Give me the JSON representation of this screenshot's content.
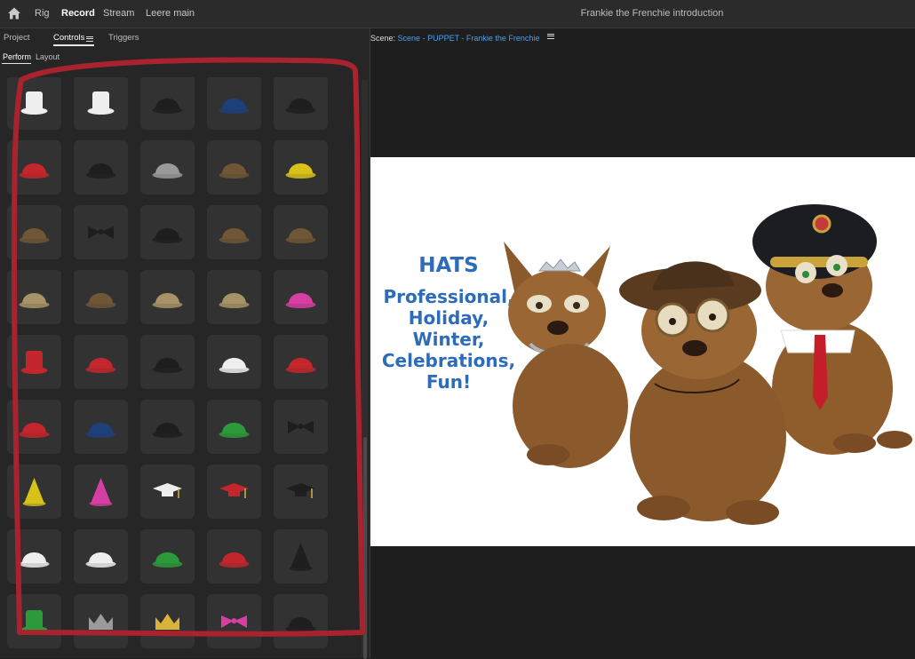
{
  "header": {
    "nav": [
      "Rig",
      "Record",
      "Stream",
      "Leere main"
    ],
    "active_nav": "Record",
    "document_title": "Frankie the Frenchie introduction"
  },
  "left_panel": {
    "tabs": [
      "Project",
      "Controls",
      "Triggers"
    ],
    "active_tab": "Controls",
    "subtabs": [
      "Perform",
      "Layout"
    ],
    "active_subtab": "Perform",
    "hat_tiles": [
      "chef-hat-icon-gray",
      "chef-hat-icon-white",
      "captain-cap-icon",
      "police-cap-icon",
      "pirate-hat-icon",
      "fire-helmet-icon",
      "aviator-cap-icon",
      "fedora-gray-icon",
      "safari-hat-icon",
      "hard-hat-icon",
      "bucket-hat-icon",
      "bowler-hat-icon",
      "knit-cap-icon",
      "viking-helmet-icon",
      "flat-hat-icon",
      "boonie-hat-icon",
      "ivy-cap-icon",
      "panama-hat-icon",
      "straw-hat-icon",
      "pink-fedora-icon",
      "red-top-hat-icon",
      "red-beret-icon",
      "black-beret-icon",
      "baseball-cap-white-icon",
      "baseball-cap-red-icon",
      "red-beanie-icon",
      "blue-beanie-icon",
      "earflap-hat-icon",
      "green-beanie-icon",
      "rainbow-beanie-icon",
      "party-hat-yellow-icon",
      "party-hat-pink-icon",
      "graduation-cap-white-icon",
      "graduation-cap-red-icon",
      "graduation-cap-black-icon",
      "reindeer-hat-icon",
      "santa-hat-icon",
      "green-elf-hat-icon",
      "uncle-sam-hat-icon",
      "witch-hat-icon",
      "leprechaun-hat-icon",
      "tiara-icon",
      "gold-crown-icon",
      "pink-bow-icon",
      "propeller-beanie-icon"
    ]
  },
  "scene": {
    "label": "Scene:",
    "name": "Scene - PUPPET - Frankie the Frenchie"
  },
  "artwork": {
    "title": "HATS",
    "lines": [
      "Professional,",
      "Holiday,",
      "Winter,",
      "Celebrations,",
      "Fun!"
    ]
  },
  "colors": {
    "accent_blue": "#4f9ee8",
    "annotation_red": "#a8232e",
    "artwork_text": "#2e6bb8"
  }
}
